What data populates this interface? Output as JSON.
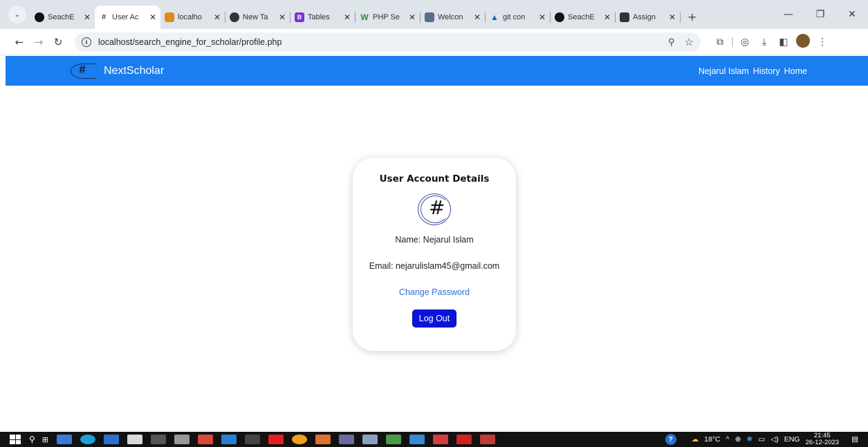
{
  "browser": {
    "tabs": [
      {
        "title": "SeachE",
        "favicon": "github-icon",
        "color": "#111111",
        "active": false
      },
      {
        "title": "User Ac",
        "favicon": "nextscholar-icon",
        "color": "#444444",
        "active": true
      },
      {
        "title": "localho",
        "favicon": "xampp-icon",
        "color": "#e08a1e",
        "active": false
      },
      {
        "title": "New Ta",
        "favicon": "chrome-icon",
        "color": "#333333",
        "active": false
      },
      {
        "title": "Tables",
        "favicon": "bootstrap-icon",
        "color": "#7a2fd6",
        "active": false
      },
      {
        "title": "PHP Se",
        "favicon": "w3schools-icon",
        "color": "#1f8f3a",
        "active": false
      },
      {
        "title": "Welcon",
        "favicon": "phpmyadmin-icon",
        "color": "#5a6e8c",
        "active": false
      },
      {
        "title": "git con",
        "favicon": "atlassian-icon",
        "color": "#1f5fd6",
        "active": false
      },
      {
        "title": "SeachE",
        "favicon": "github-icon",
        "color": "#111111",
        "active": false
      },
      {
        "title": "Assign",
        "favicon": "classroom-icon",
        "color": "#333333",
        "active": false
      }
    ],
    "url": "localhost/search_engine_for_scholar/profile.php"
  },
  "site": {
    "brand": "NextScholar",
    "nav": {
      "user": "Nejarul Islam",
      "history": "History",
      "home": "Home"
    },
    "primary_color": "#1a7df0"
  },
  "card": {
    "title": "User Account Details",
    "name_line": "Name: Nejarul Islam",
    "email_line": "Email: nejarulislam45@gmail.com",
    "change_password": "Change Password",
    "logout": "Log Out"
  },
  "taskbar": {
    "weather": "18°C",
    "language": "ENG",
    "time": "21:45",
    "date": "26-12-2023"
  }
}
